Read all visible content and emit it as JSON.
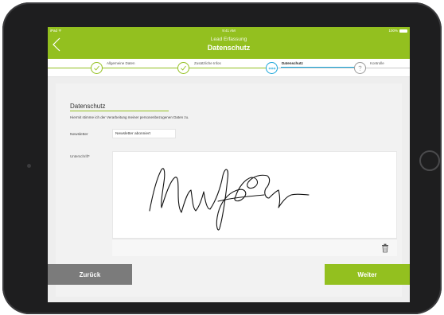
{
  "status_bar": {
    "carrier": "iPad ᯤ",
    "time": "9:41 AM",
    "battery": "100%"
  },
  "header": {
    "subtitle": "Lead Erfassung",
    "title": "Datenschutz",
    "back_icon": "chevron-left-icon"
  },
  "stepper": {
    "steps": [
      {
        "label": "Allgemeine Daten",
        "state": "done"
      },
      {
        "label": "Zusätzliche Infos",
        "state": "done"
      },
      {
        "label": "Datenschutz",
        "state": "active"
      },
      {
        "label": "Kontrolle",
        "state": "pending"
      }
    ],
    "icons": [
      "check-icon",
      "check-icon",
      "dots-icon",
      "question-icon"
    ]
  },
  "form": {
    "section_title": "Datenschutz",
    "consent_text": "Hiermit stimme ich der Verarbeitung meiner personenbezogenen Daten zu.",
    "newsletter_label": "Newsletter",
    "newsletter_value": "Newsletter abonniert",
    "signature_label": "Unterschrift*",
    "trash_icon": "trash-icon"
  },
  "buttons": {
    "back_label": "Zurück",
    "next_label": "Weiter"
  },
  "colors": {
    "accent": "#93c01f",
    "active_step": "#1aa5d9",
    "back_button": "#7b7b7b",
    "frame": "#1e1e1f"
  }
}
